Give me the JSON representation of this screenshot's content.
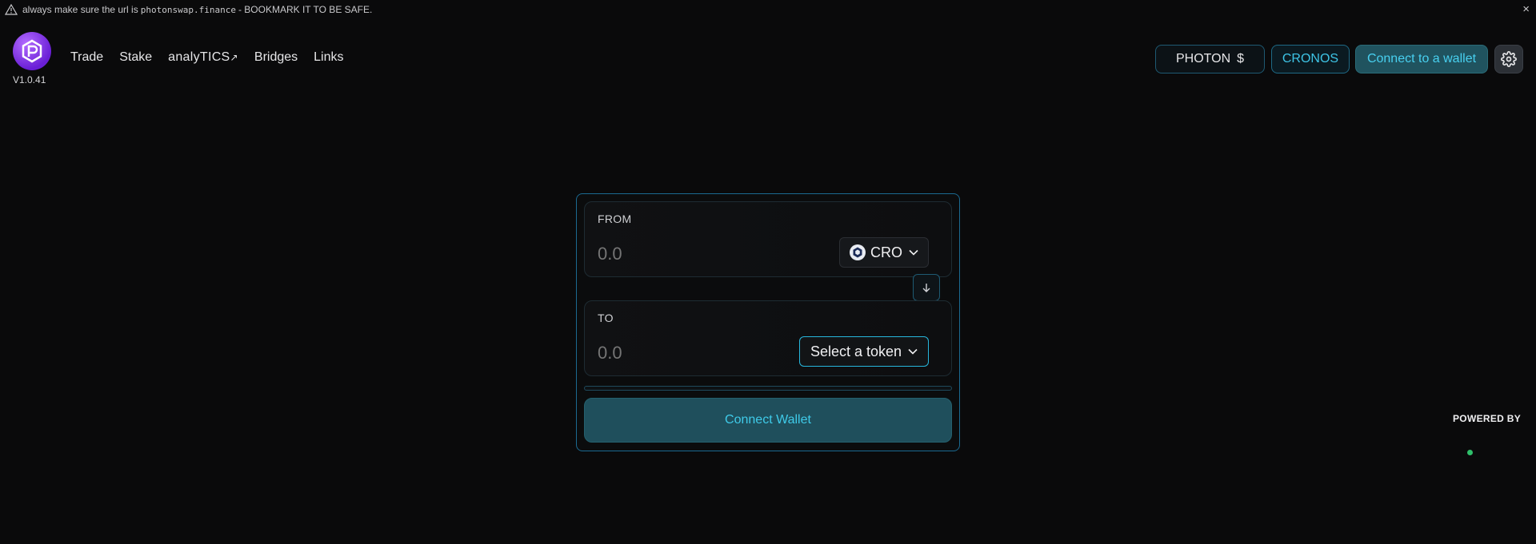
{
  "banner": {
    "prefix": "always make sure the url is",
    "url": "photonswap.finance",
    "suffix": "- BOOKMARK IT TO BE SAFE.",
    "close_label": "×"
  },
  "header": {
    "version": "V1.0.41",
    "nav": [
      {
        "label": "Trade"
      },
      {
        "label": "Stake"
      },
      {
        "label": "analyTICS",
        "ext": "↗"
      },
      {
        "label": "Bridges"
      },
      {
        "label": "Links"
      }
    ],
    "photon_label": "PHOTON",
    "photon_price": "$",
    "network_label": "CRONOS",
    "connect_label": "Connect to a wallet"
  },
  "swap": {
    "from_label": "FROM",
    "from_amount": "0.0",
    "from_token": "CRO",
    "to_label": "TO",
    "to_amount": "0.0",
    "to_token": "Select a token",
    "connect_wallet_label": "Connect Wallet"
  },
  "footer": {
    "powered_by": "POWERED BY"
  },
  "colors": {
    "accent": "#3ec4e6",
    "logo": "#7b2cf0",
    "status": "#2fbf6a"
  }
}
